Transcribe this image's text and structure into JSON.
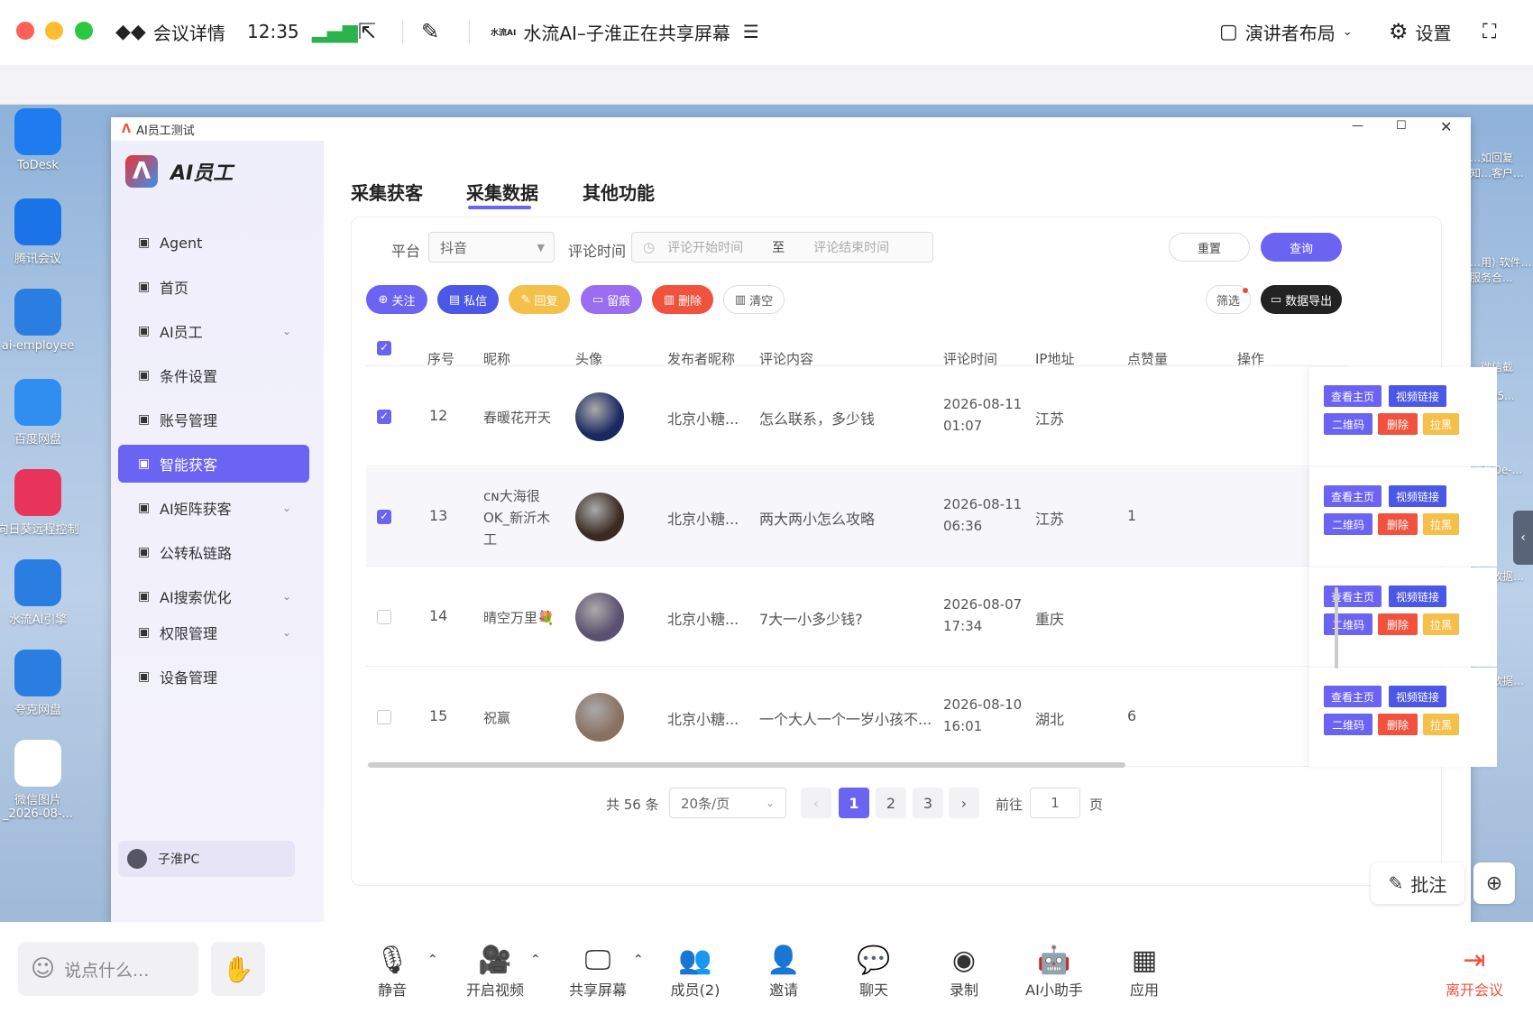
{
  "meeting": {
    "title": "会议详情",
    "time": "12:35",
    "share_text": "水流AI–子淮正在共享屏幕",
    "share_logo": "水流AI",
    "layout_label": "演讲者布局",
    "settings_label": "设置"
  },
  "desktop_icons": [
    {
      "label": "ToDesk",
      "color": "#1e7cf0"
    },
    {
      "label": "腾讯会议",
      "color": "#1b73e8"
    },
    {
      "label": "ai-employee",
      "color": "#2a7de1"
    },
    {
      "label": "百度网盘",
      "color": "#2f8ef0"
    },
    {
      "label": "向日葵远程控制",
      "color": "#e8345a"
    },
    {
      "label": "水流AI引擎",
      "color": "#2a7de1"
    },
    {
      "label": "夸克网盘",
      "color": "#2a7de1"
    },
    {
      "label": "微信图片_2026-08-...",
      "color": "#ffffff"
    }
  ],
  "desktop_right_labels": [
    "…如回复知…客户...",
    "…用) 软件…服务合...",
    "…微信截图…86605...",
    "…760e-...",
    "…表数据…png",
    "…次数据…png"
  ],
  "window": {
    "title": "AI员工测试"
  },
  "app": {
    "brand": "AI员工",
    "user": "子淮PC"
  },
  "sidebar": [
    {
      "label": "Agent",
      "icon": "chat-icon",
      "active": false,
      "chevron": false
    },
    {
      "label": "首页",
      "icon": "home-icon",
      "active": false,
      "chevron": false
    },
    {
      "label": "AI员工",
      "icon": "ai-icon",
      "active": false,
      "chevron": true
    },
    {
      "label": "条件设置",
      "icon": "condition-icon",
      "active": false,
      "chevron": false
    },
    {
      "label": "账号管理",
      "icon": "account-icon",
      "active": false,
      "chevron": false
    },
    {
      "label": "智能获客",
      "icon": "gear-icon",
      "active": true,
      "chevron": false
    },
    {
      "label": "AI矩阵获客",
      "icon": "matrix-icon",
      "active": false,
      "chevron": true
    },
    {
      "label": "公转私链路",
      "icon": "link-icon",
      "active": false,
      "chevron": false
    },
    {
      "label": "AI搜索优化",
      "icon": "search-opt-icon",
      "active": false,
      "chevron": true
    },
    {
      "label": "权限管理",
      "icon": "users-icon",
      "active": false,
      "chevron": true
    },
    {
      "label": "设备管理",
      "icon": "device-icon",
      "active": false,
      "chevron": false
    }
  ],
  "tabs": [
    "采集获客",
    "采集数据",
    "其他功能"
  ],
  "filter": {
    "platform_label": "平台",
    "platform_value": "抖音",
    "time_label": "评论时间",
    "start_placeholder": "评论开始时间",
    "to": "至",
    "end_placeholder": "评论结束时间",
    "reset": "重置",
    "query": "查询"
  },
  "actions": [
    {
      "label": "关注",
      "color": "#6b63f2",
      "icon": "⊕"
    },
    {
      "label": "私信",
      "color": "#4b57e6",
      "icon": "▤"
    },
    {
      "label": "回复",
      "color": "#f5c04a",
      "icon": "✎"
    },
    {
      "label": "留痕",
      "color": "#9b6cf0",
      "icon": "▭"
    },
    {
      "label": "删除",
      "color": "#f0523e",
      "icon": "▥"
    }
  ],
  "clear_label": "清空",
  "filter_btn": "筛选",
  "export_btn": "数据导出",
  "columns": [
    "序号",
    "昵称",
    "头像",
    "发布者昵称",
    "评论内容",
    "评论时间",
    "IP地址",
    "点赞量",
    "操作"
  ],
  "rows": [
    {
      "checked": true,
      "id": "12",
      "nick": "春暖花开天",
      "publisher": "北京小糖...",
      "comment": "怎么联系，多少钱",
      "time": "2026-08-11",
      "clock": "01:07",
      "ip": "江苏",
      "likes": "",
      "avatar": "#1a2860"
    },
    {
      "checked": true,
      "id": "13",
      "nick": "ᴄɴ大海很OK_新沂木工",
      "publisher": "北京小糖...",
      "comment": "两大两小怎么攻略",
      "time": "2026-08-11",
      "clock": "06:36",
      "ip": "江苏",
      "likes": "1",
      "avatar": "#3a2a20"
    },
    {
      "checked": false,
      "id": "14",
      "nick": "晴空万里💐",
      "publisher": "北京小糖...",
      "comment": "7大一小多少钱?",
      "time": "2026-08-07",
      "clock": "17:34",
      "ip": "重庆",
      "likes": "",
      "avatar": "#5a5070"
    },
    {
      "checked": false,
      "id": "15",
      "nick": "祝赢",
      "publisher": "北京小糖...",
      "comment": "一个大人一个一岁小孩不...",
      "time": "2026-08-10",
      "clock": "16:01",
      "ip": "湖北",
      "likes": "6",
      "avatar": "#8a7060"
    }
  ],
  "row_ops": {
    "home": "查看主页",
    "video": "视频链接",
    "qr": "二维码",
    "del": "删除",
    "black": "拉黑"
  },
  "pagination": {
    "total": "共 56 条",
    "per_page": "20条/页",
    "pages": [
      "1",
      "2",
      "3"
    ],
    "current": "1",
    "goto": "前往",
    "goto_value": "1",
    "page_unit": "页"
  },
  "annotate": "批注",
  "chat_placeholder": "说点什么...",
  "bottom": [
    {
      "label": "静音",
      "icon": "🎙",
      "caret": true
    },
    {
      "label": "开启视频",
      "icon": "🎥",
      "caret": true
    },
    {
      "label": "共享屏幕",
      "icon": "🖵",
      "caret": true
    },
    {
      "label": "成员(2)",
      "icon": "👥",
      "caret": false
    },
    {
      "label": "邀请",
      "icon": "👤",
      "caret": false
    },
    {
      "label": "聊天",
      "icon": "💬",
      "caret": false
    },
    {
      "label": "录制",
      "icon": "◉",
      "caret": false
    },
    {
      "label": "AI小助手",
      "icon": "🤖",
      "caret": false
    },
    {
      "label": "应用",
      "icon": "▦",
      "caret": false
    }
  ],
  "leave": "离开会议"
}
